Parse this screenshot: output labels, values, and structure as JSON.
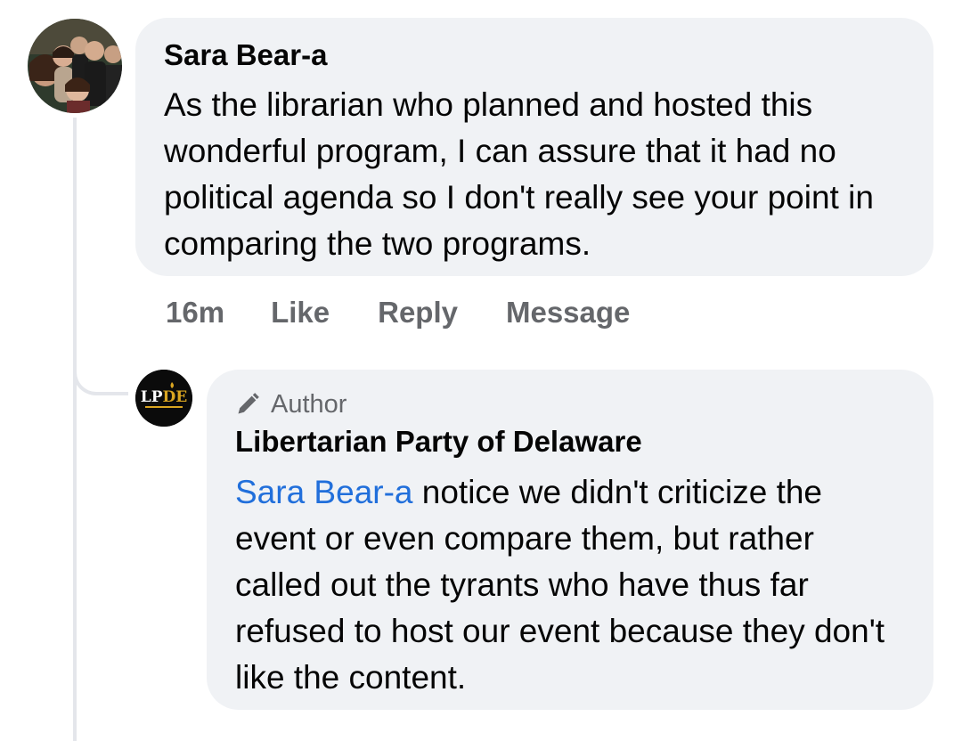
{
  "comment": {
    "author": "Sara Bear-a",
    "text": "As the librarian who planned and hosted this wonderful program, I can assure that it had no political agenda so I don't really see your point in comparing the two programs.",
    "actions": {
      "time": "16m",
      "like": "Like",
      "reply": "Reply",
      "message": "Message"
    }
  },
  "reply": {
    "badge": "Author",
    "badge_icon": "pencil-icon",
    "author": "Libertarian Party of Delaware",
    "avatar_text": "LPDE",
    "mention": "Sara Bear-a",
    "text": "notice we didn't criticize the event or even compare them, but rather called out the tyrants who have thus far refused to host our event because they don't like the content."
  },
  "colors": {
    "bubble": "#f0f2f5",
    "mention": "#216fdb",
    "secondary_text": "#65676b",
    "logo_gold": "#d9a521"
  }
}
